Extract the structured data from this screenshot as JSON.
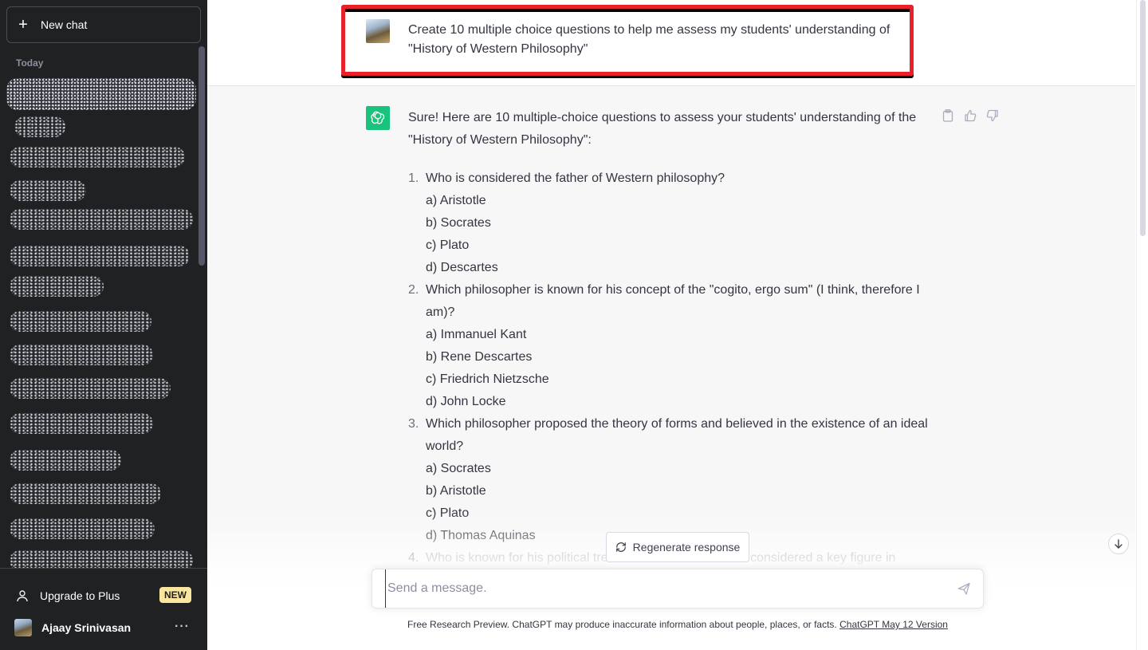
{
  "sidebar": {
    "new_chat_label": "New chat",
    "section_today": "Today",
    "upgrade_label": "Upgrade to Plus",
    "upgrade_badge": "NEW",
    "user_name": "Ajaay Srinivasan",
    "more_dots": "···"
  },
  "conversation": {
    "user_message": "Create 10 multiple choice questions to help me assess my students' understanding of \"History of Western Philosophy\"",
    "assistant_intro": "Sure! Here are 10 multiple-choice questions to assess your students' understanding of the \"History of Western Philosophy\":",
    "questions": [
      {
        "num": "1.",
        "text": "Who is considered the father of Western philosophy?",
        "options": [
          "a) Aristotle",
          "b) Socrates",
          "c) Plato",
          "d) Descartes"
        ]
      },
      {
        "num": "2.",
        "text": "Which philosopher is known for his concept of the \"cogito, ergo sum\" (I think, therefore I am)?",
        "options": [
          "a) Immanuel Kant",
          "b) Rene Descartes",
          "c) Friedrich Nietzsche",
          "d) John Locke"
        ]
      },
      {
        "num": "3.",
        "text": "Which philosopher proposed the theory of forms and believed in the existence of an ideal world?",
        "options": [
          "a) Socrates",
          "b) Aristotle",
          "c) Plato",
          "d) Thomas Aquinas"
        ]
      },
      {
        "num": "4.",
        "text": "Who is known for his political treatise \"The Prince\" and is considered a key figure in",
        "options": []
      }
    ]
  },
  "composer": {
    "regenerate_label": "Regenerate response",
    "placeholder": "Send a message."
  },
  "footer": {
    "text": "Free Research Preview. ChatGPT may produce inaccurate information about people, places, or facts. ",
    "link": "ChatGPT May 12 Version"
  },
  "colors": {
    "sidebar_bg": "#202123",
    "assistant_bg": "#f7f7f8",
    "openai_green": "#19c37d",
    "highlight_red": "#e8202a",
    "badge_yellow": "#fae69e"
  },
  "icons": {
    "new_chat": "plus-icon",
    "upgrade": "user-icon",
    "copy": "clipboard-icon",
    "like": "thumbs-up-icon",
    "dislike": "thumbs-down-icon",
    "regenerate": "refresh-icon",
    "send": "send-icon",
    "scroll": "arrow-down-icon"
  }
}
